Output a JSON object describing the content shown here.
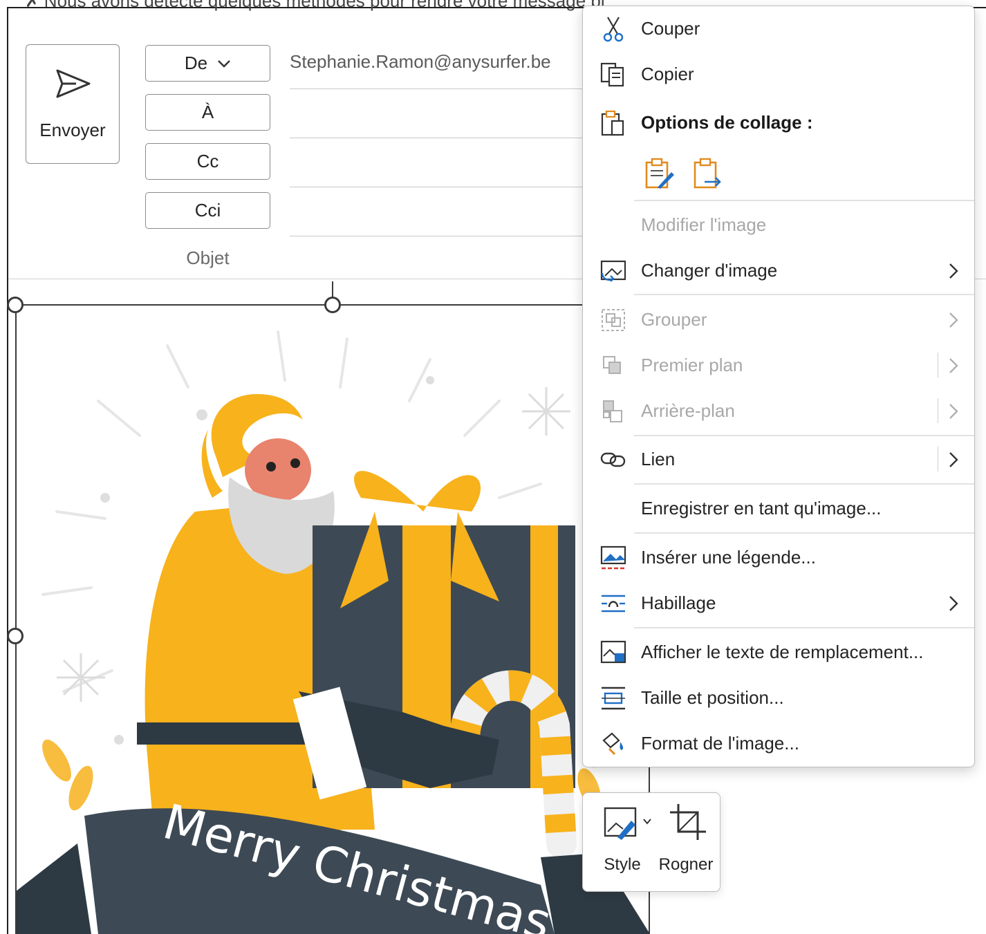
{
  "info_bar": {
    "text": "Nous avons détecté quelques méthodes pour rendre votre message pl"
  },
  "compose": {
    "send_label": "Envoyer",
    "from_label": "De",
    "to_label": "À",
    "cc_label": "Cc",
    "bcc_label": "Cci",
    "subject_label": "Objet",
    "from_address": "Stephanie.Ramon@anysurfer.be"
  },
  "image": {
    "banner_text": "Merry Christmas",
    "colors": {
      "yellow": "#f7b21c",
      "dark": "#3d4a55",
      "skin": "#e8836d",
      "beard": "#d9d9d9"
    }
  },
  "context_menu": {
    "cut": "Couper",
    "copy": "Copier",
    "paste_options": "Options de collage :",
    "edit_image": "Modifier l'image",
    "change_image": "Changer d'image",
    "group": "Grouper",
    "bring_forward": "Premier plan",
    "send_backward": "Arrière-plan",
    "link": "Lien",
    "save_as_image": "Enregistrer en tant qu'image...",
    "insert_caption": "Insérer une légende...",
    "wrap_text": "Habillage",
    "view_alt_text": "Afficher le texte de remplacement...",
    "size_position": "Taille et position...",
    "format_picture": "Format de l'image..."
  },
  "mini_toolbar": {
    "style": "Style",
    "crop": "Rogner"
  },
  "accent_colors": {
    "icon_blue": "#1f6fc5",
    "icon_orange": "#e08a1e",
    "disabled_text": "#a8a8a8"
  }
}
